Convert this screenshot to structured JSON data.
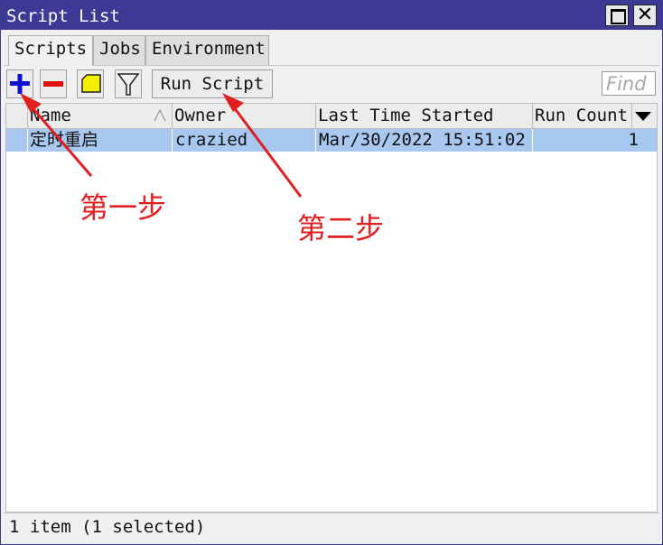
{
  "window": {
    "title": "Script List"
  },
  "tabs": [
    {
      "label": "Scripts",
      "active": true
    },
    {
      "label": "Jobs",
      "active": false
    },
    {
      "label": "Environment",
      "active": false
    }
  ],
  "toolbar": {
    "add_icon": "plus-icon",
    "remove_icon": "minus-icon",
    "comment_icon": "note-icon",
    "filter_icon": "filter-icon",
    "run_label": "Run Script",
    "find_placeholder": "Find"
  },
  "table": {
    "columns": [
      "Name",
      "Owner",
      "Last Time Started",
      "Run Count"
    ],
    "rows": [
      {
        "name": "定时重启",
        "owner": "crazied",
        "last_started": "Mar/30/2022 15:51:02",
        "run_count": "1",
        "selected": true
      }
    ]
  },
  "status": "1 item (1 selected)",
  "annotations": {
    "step1": "第一步",
    "step2": "第二步"
  },
  "colors": {
    "titlebar": "#3d3a95",
    "selection": "#a8c8f0",
    "annotation": "#e02020",
    "add": "#1010d0",
    "remove": "#e01010",
    "note": "#f5f000"
  }
}
